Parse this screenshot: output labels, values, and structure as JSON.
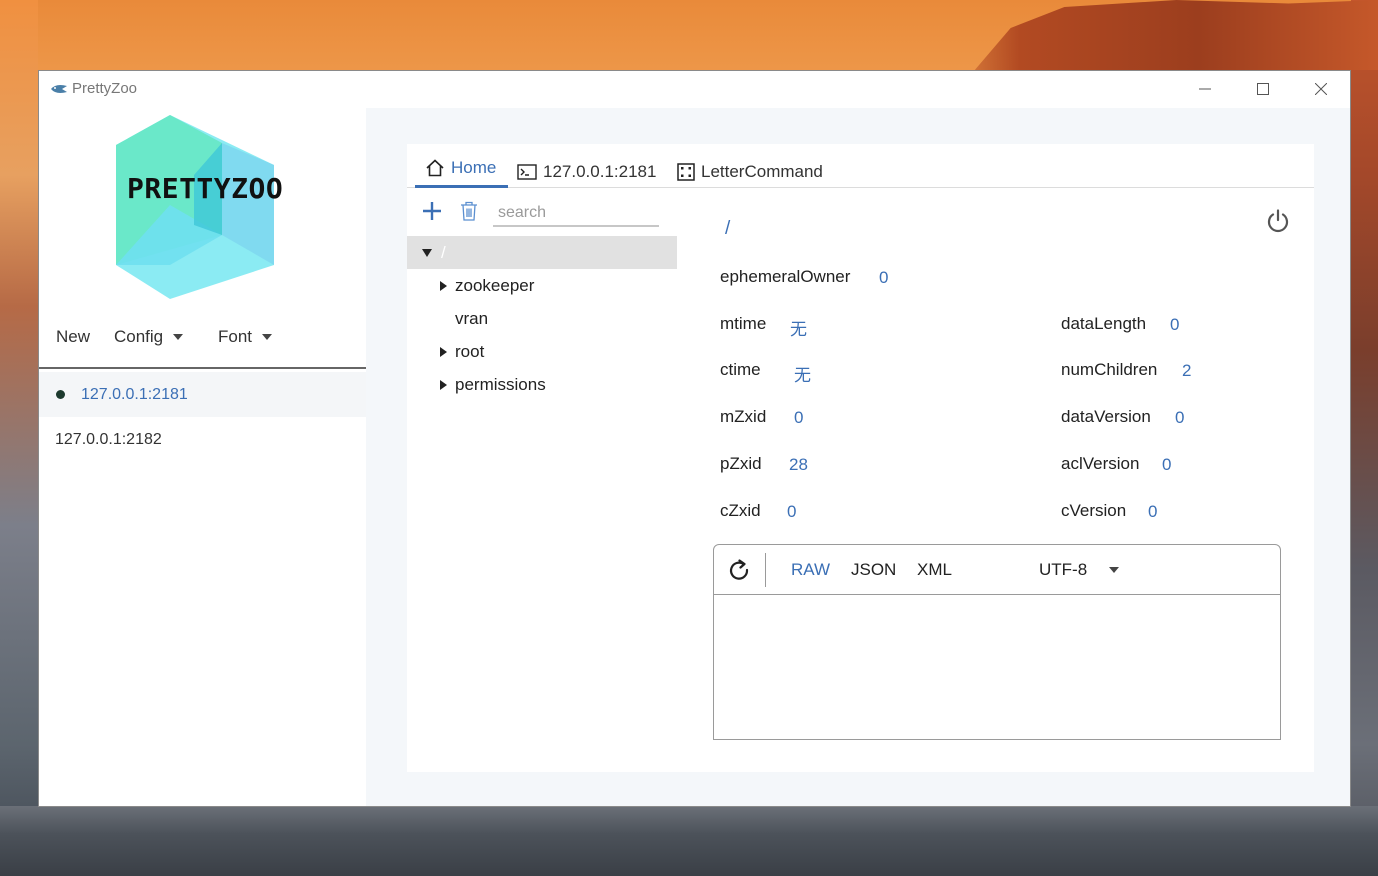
{
  "window": {
    "title": "PrettyZoo",
    "controls": {
      "minimize": "minimize",
      "maximize": "maximize",
      "close": "close"
    }
  },
  "sidebar": {
    "logo_text": "PRETTYZOO",
    "menu": {
      "new": "New",
      "config": "Config",
      "font": "Font"
    },
    "servers": [
      {
        "label": "127.0.0.1:2181",
        "connected": true
      },
      {
        "label": "127.0.0.1:2182",
        "connected": false
      }
    ]
  },
  "tabs": [
    {
      "label": "Home",
      "icon": "home-icon",
      "active": true
    },
    {
      "label": "127.0.0.1:2181",
      "icon": "terminal-icon",
      "active": false
    },
    {
      "label": "LetterCommand",
      "icon": "dice-icon",
      "active": false
    }
  ],
  "tree_toolbar": {
    "search_placeholder": "search"
  },
  "tree": {
    "nodes": [
      {
        "label": "/",
        "expanded": true,
        "selected": true
      },
      {
        "label": "zookeeper",
        "expandable": true
      },
      {
        "label": "vran",
        "expandable": false
      },
      {
        "label": "root",
        "expandable": true
      },
      {
        "label": "permissions",
        "expandable": true
      }
    ]
  },
  "detail": {
    "path": "/",
    "fields": {
      "ephemeralOwner": {
        "label": "ephemeralOwner",
        "value": "0"
      },
      "mtime": {
        "label": "mtime",
        "value": "无"
      },
      "ctime": {
        "label": "ctime",
        "value": "无"
      },
      "mZxid": {
        "label": "mZxid",
        "value": "0"
      },
      "pZxid": {
        "label": "pZxid",
        "value": "28"
      },
      "cZxid": {
        "label": "cZxid",
        "value": "0"
      },
      "dataLength": {
        "label": "dataLength",
        "value": "0"
      },
      "numChildren": {
        "label": "numChildren",
        "value": "2"
      },
      "dataVersion": {
        "label": "dataVersion",
        "value": "0"
      },
      "aclVersion": {
        "label": "aclVersion",
        "value": "0"
      },
      "cVersion": {
        "label": "cVersion",
        "value": "0"
      }
    }
  },
  "editor": {
    "formats": [
      "RAW",
      "JSON",
      "XML"
    ],
    "active_format": "RAW",
    "charset": "UTF-8",
    "content": ""
  },
  "colors": {
    "accent": "#3b6fb5",
    "panel_bg": "#f4f7fa",
    "selected_row": "#e1e1e1"
  }
}
